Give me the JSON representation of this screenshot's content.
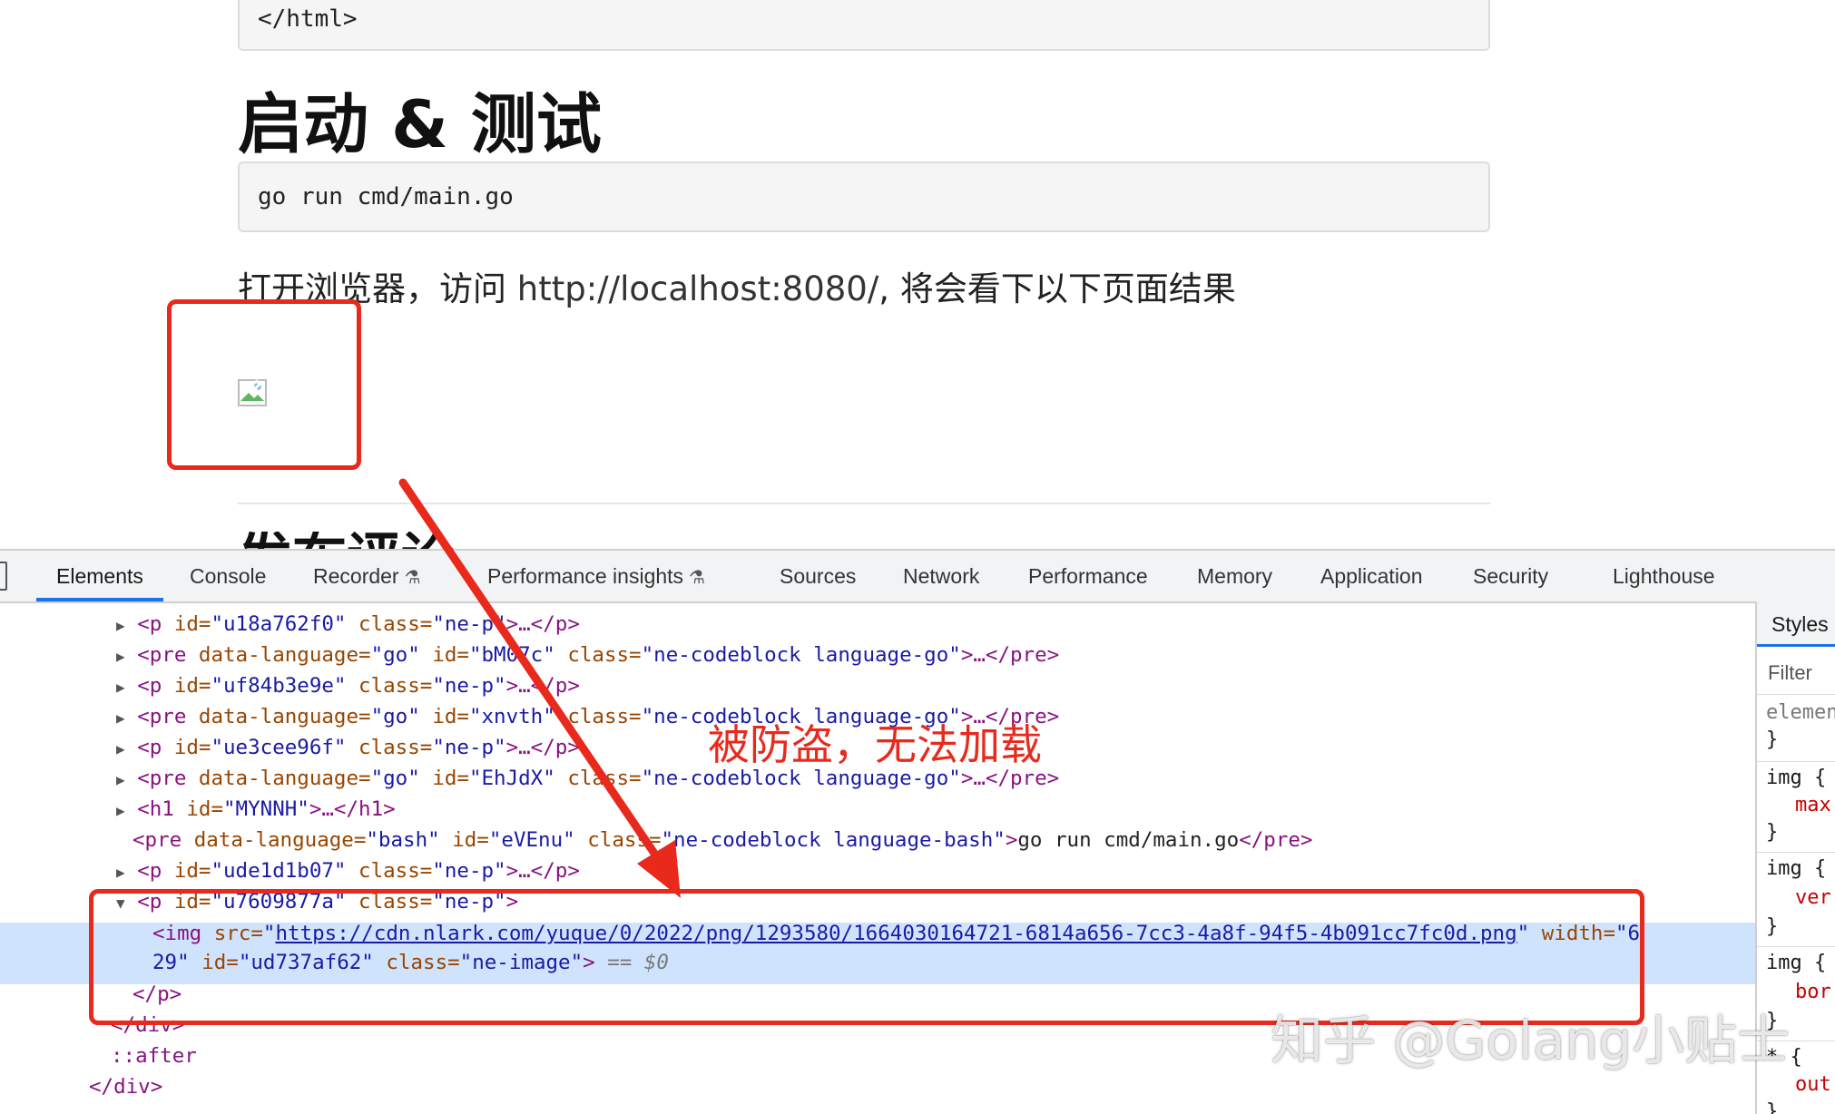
{
  "page": {
    "code_top": "</html>",
    "heading": "启动 & 测试",
    "code_go": "go run cmd/main.go",
    "para_before": "打开浏览器，访问 ",
    "para_url": "http://localhost:8080/",
    "para_after": ", 将会看下以下页面结果",
    "cut_heading": "发布评论"
  },
  "annotation": "被防盗，无法加载",
  "devtools": {
    "tabs": [
      "Elements",
      "Console",
      "Recorder",
      "Performance insights",
      "Sources",
      "Network",
      "Performance",
      "Memory",
      "Application",
      "Security",
      "Lighthouse"
    ],
    "dom": {
      "l1": {
        "open": "<p",
        "id": "\"u18a762f0\"",
        "cls": "\"ne-p\"",
        "tail": ">…</p>"
      },
      "l2": {
        "open": "<pre",
        "lang": "\"go\"",
        "id": "\"bM07c\"",
        "cls": "\"ne-codeblock language-go\"",
        "tail": ">…</pre>"
      },
      "l3": {
        "open": "<p",
        "id": "\"uf84b3e9e\"",
        "cls": "\"ne-p\"",
        "tail": ">…</p>"
      },
      "l4": {
        "open": "<pre",
        "lang": "\"go\"",
        "id": "\"xnvth\"",
        "cls": "\"ne-codeblock language-go\"",
        "tail": ">…</pre>"
      },
      "l5": {
        "open": "<p",
        "id": "\"ue3cee96f\"",
        "cls": "\"ne-p\"",
        "tail": ">…</p>"
      },
      "l6": {
        "open": "<pre",
        "lang": "\"go\"",
        "id": "\"EhJdX\"",
        "cls": "\"ne-codeblock language-go\"",
        "tail": ">…</pre>"
      },
      "l7": {
        "open": "<h1",
        "id": "\"MYNNH\"",
        "tail": ">…</h1>"
      },
      "l8": {
        "open": "<pre",
        "lang": "\"bash\"",
        "id": "\"eVEnu\"",
        "cls": "\"ne-codeblock language-bash\"",
        "gt": ">",
        "text": "go run cmd/main.go",
        "close": "</pre>"
      },
      "l9": {
        "open": "<p",
        "id": "\"ude1d1b07\"",
        "cls": "\"ne-p\"",
        "tail": ">…</p>"
      },
      "l10": {
        "open": "<p",
        "id": "\"u7609877a\"",
        "cls": "\"ne-p\"",
        "tail": ">"
      },
      "l11": {
        "open": "<img",
        "src_url": "https://cdn.nlark.com/yuque/0/2022/png/1293580/1664030164721-6814a656-7cc3-4a8f-94f5-4b091cc7fc0d.png",
        "width_part": "\"6"
      },
      "l12": {
        "width_rest": "29\"",
        "id": "\"ud737af62\"",
        "cls": "\"ne-image\"",
        "gt": ">",
        "eq": " == $0"
      },
      "l13": "</p>",
      "l14": "</div>",
      "l15": "::after",
      "l16": "</div>"
    },
    "attr_names": {
      "id": "id=",
      "class": "class=",
      "data_language": "data-language=",
      "src": "src=",
      "width": "width="
    },
    "styles": {
      "tab": "Styles",
      "filter": "Filter",
      "rules": [
        "elemen",
        "}",
        "img {",
        "max",
        "}",
        "img {",
        "ver",
        "}",
        "img {",
        "bor",
        "}",
        "* {",
        "out",
        "}"
      ]
    }
  },
  "watermark": "知乎 @Golang小贴士",
  "colors": {
    "accent": "#1a73e8",
    "annotation_red": "#e8291c",
    "selected_row": "#cfe3fc"
  }
}
